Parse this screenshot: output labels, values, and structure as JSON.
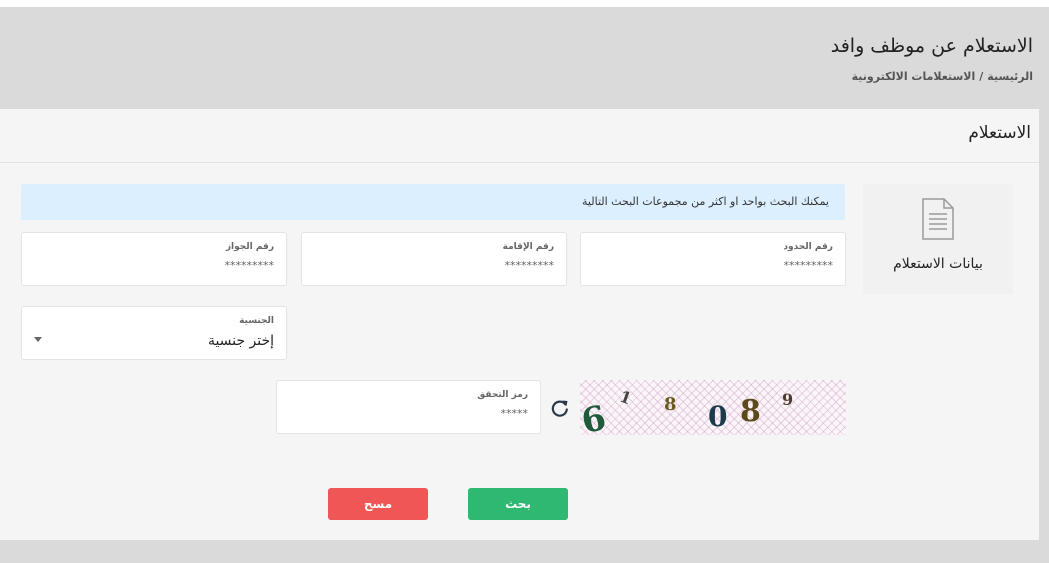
{
  "header": {
    "title": "الاستعلام عن موظف وافد",
    "breadcrumb": {
      "home": "الرئيسية",
      "separator": "/",
      "current": "الاستعلامات الالكترونية"
    }
  },
  "card": {
    "title": "الاستعلام",
    "side_tab": {
      "label": "بيانات الاستعلام",
      "icon": "document-icon"
    },
    "info_message": "يمكنك البحث بواحد او اكثر من مجموعات البحث التالية",
    "fields": {
      "border_number": {
        "label": "رقم الحدود",
        "placeholder": "*********"
      },
      "iqama_number": {
        "label": "رقم الإقامة",
        "placeholder": "*********"
      },
      "passport_number": {
        "label": "رقم الجواز",
        "placeholder": "*********"
      },
      "nationality": {
        "label": "الجنسية",
        "selected": "إختر جنسية"
      },
      "captcha_code": {
        "label": "رمز التحقق",
        "placeholder": "*****"
      }
    },
    "captcha": {
      "digits": [
        "6",
        "1",
        "8",
        "0",
        "8",
        "9"
      ],
      "colors": [
        "#1f5a3a",
        "#444444",
        "#6b5a1f",
        "#1e3a4a",
        "#5a4a1a",
        "#4a3a2a"
      ]
    },
    "buttons": {
      "search": "بحث",
      "clear": "مسح"
    }
  },
  "colors": {
    "search_button": "#2eb872",
    "clear_button": "#f05656",
    "info_box": "#dcefff"
  }
}
